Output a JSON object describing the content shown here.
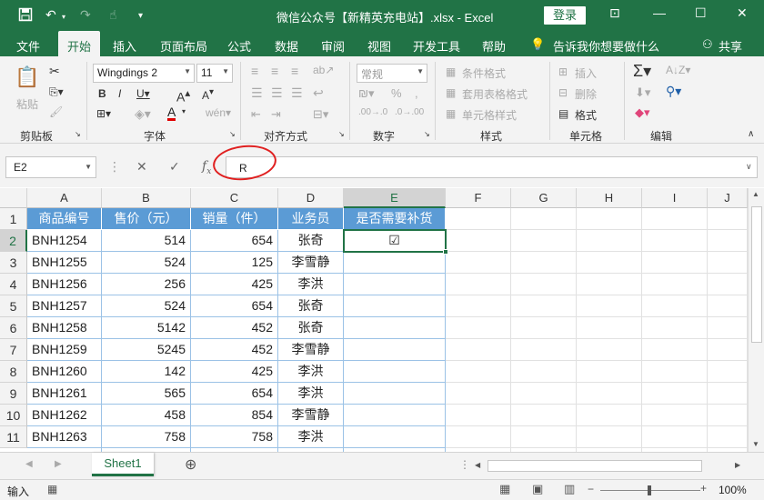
{
  "title_bar": {
    "title": "微信公众号【新精英充电站】.xlsx - Excel",
    "signin": "登录"
  },
  "tabs": [
    "文件",
    "开始",
    "插入",
    "页面布局",
    "公式",
    "数据",
    "审阅",
    "视图",
    "开发工具",
    "帮助"
  ],
  "tell_me": "告诉我你想要做什么",
  "share": "共享",
  "ribbon": {
    "clipboard": {
      "label": "剪贴板",
      "paste": "粘贴"
    },
    "font": {
      "label": "字体",
      "font_name": "Wingdings 2",
      "font_size": "11"
    },
    "alignment": {
      "label": "对齐方式"
    },
    "number": {
      "label": "数字",
      "format": "常规"
    },
    "styles": {
      "label": "样式",
      "conditional": "条件格式",
      "table": "套用表格格式",
      "cell_styles": "单元格样式"
    },
    "cells": {
      "label": "单元格",
      "insert": "插入",
      "delete": "删除",
      "format": "格式"
    },
    "editing": {
      "label": "编辑"
    }
  },
  "formula_bar": {
    "name_box": "E2",
    "formula": "R"
  },
  "columns": [
    "A",
    "B",
    "C",
    "D",
    "E",
    "F",
    "G",
    "H",
    "I",
    "J"
  ],
  "rows": [
    "1",
    "2",
    "3",
    "4",
    "5",
    "6",
    "7",
    "8",
    "9",
    "10",
    "11"
  ],
  "table_headers": [
    "商品编号",
    "售价（元）",
    "销量（件）",
    "业务员",
    "是否需要补货"
  ],
  "table_rows": [
    [
      "BNH1254",
      "514",
      "654",
      "张奇",
      "☑"
    ],
    [
      "BNH1255",
      "524",
      "125",
      "李雪静",
      ""
    ],
    [
      "BNH1256",
      "256",
      "425",
      "李洪",
      ""
    ],
    [
      "BNH1257",
      "524",
      "654",
      "张奇",
      ""
    ],
    [
      "BNH1258",
      "5142",
      "452",
      "张奇",
      ""
    ],
    [
      "BNH1259",
      "5245",
      "452",
      "李雪静",
      ""
    ],
    [
      "BNH1260",
      "142",
      "425",
      "李洪",
      ""
    ],
    [
      "BNH1261",
      "565",
      "654",
      "李洪",
      ""
    ],
    [
      "BNH1262",
      "458",
      "854",
      "李雪静",
      ""
    ],
    [
      "BNH1263",
      "758",
      "758",
      "李洪",
      ""
    ]
  ],
  "sheet": {
    "name": "Sheet1"
  },
  "status": {
    "mode": "输入",
    "zoom": "100%"
  }
}
